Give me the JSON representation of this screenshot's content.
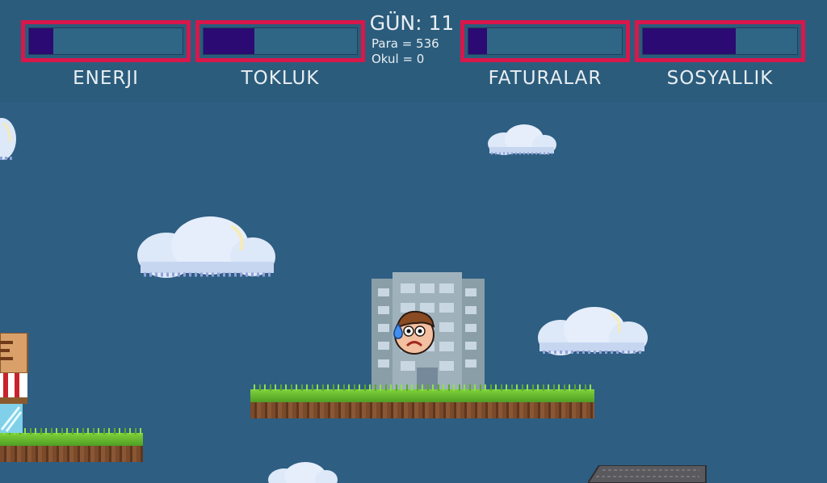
{
  "hud": {
    "day": "GÜN: 11",
    "para": "Para = 536",
    "okul": "Okul = 0",
    "bars": [
      {
        "label": "ENERJI",
        "level": 0.16
      },
      {
        "label": "TOKLUK",
        "level": 0.33
      },
      {
        "label": "FATURALAR",
        "level": 0.12
      },
      {
        "label": "SOSYALLIK",
        "level": 0.6
      }
    ]
  },
  "colors": {
    "sky": "#2e5e82",
    "hud_bg": "#2b5c7c",
    "bar_border": "#d8174b",
    "bar_fill": "#2b0a73",
    "cloud": "#dde8f8",
    "grass": "#6fc534",
    "dirt": "#6e4226",
    "building": "#8fa3ad"
  },
  "icons": [
    "player-face-icon",
    "sweat-drop-icon"
  ]
}
